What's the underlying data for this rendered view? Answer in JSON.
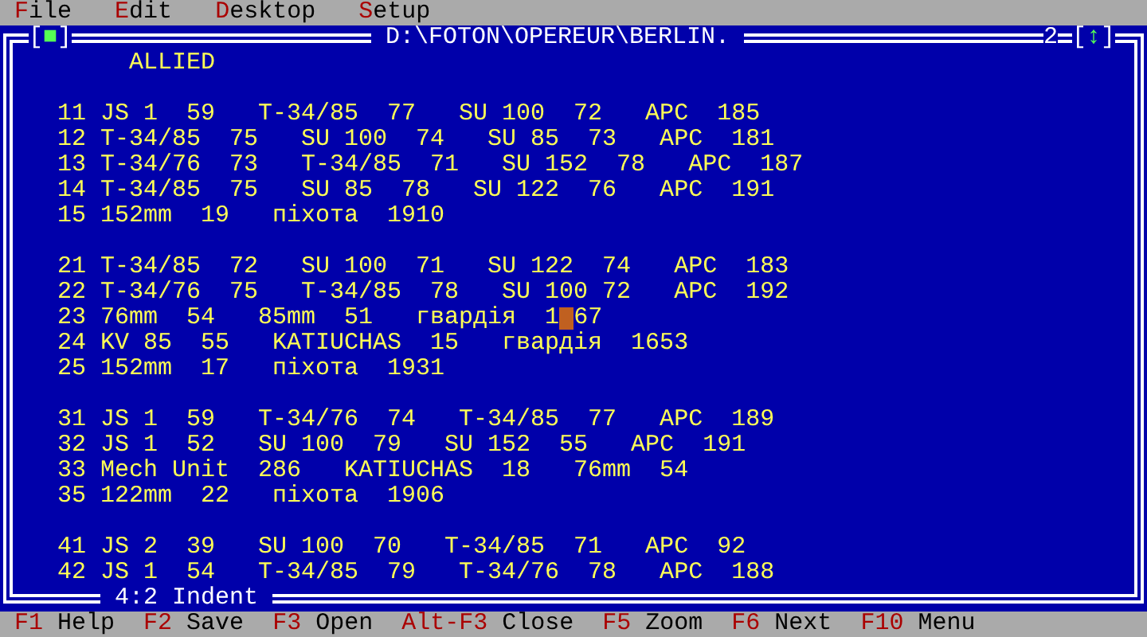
{
  "menu": [
    {
      "label": "File"
    },
    {
      "label": "Edit"
    },
    {
      "label": "Desktop"
    },
    {
      "label": "Setup"
    }
  ],
  "window": {
    "close_button": {
      "open": "[",
      "glyph": "■",
      "close": "]"
    },
    "title": "D:\\FOTON\\OPEREUR\\BERLIN.",
    "number": "2",
    "zoom_button": {
      "open": "[",
      "glyph": "↕",
      "close": "]"
    },
    "heading": "ALLIED",
    "blocks": [
      [
        {
          "text": "11 JS 1  59   T-34/85  77   SU 100  72   APC  185"
        },
        {
          "text": "12 T-34/85  75   SU 100  74   SU 85  73   APC  181"
        },
        {
          "text": "13 T-34/76  73   T-34/85  71   SU 152  78   APC  187"
        },
        {
          "text": "14 T-34/85  75   SU 85  78   SU 122  76   APC  191"
        },
        {
          "text": "15 152mm  19   піхота  1910"
        }
      ],
      [
        {
          "text": "21 T-34/85  72   SU 100  71   SU 122  74   APC  183"
        },
        {
          "text": "22 T-34/76  75   T-34/85  78   SU 100 72   APC  192"
        },
        {
          "text": "23 76mm  54   85mm  51   гвардія  1",
          "after_cursor": "67"
        },
        {
          "text": "24 KV 85  55   KATIUCHAS  15   гвардія  1653"
        },
        {
          "text": "25 152mm  17   піхота  1931"
        }
      ],
      [
        {
          "text": "31 JS 1  59   T-34/76  74   T-34/85  77   APC  189"
        },
        {
          "text": "32 JS 1  52   SU 100  79   SU 152  55   APC  191"
        },
        {
          "text": "33 Mech Unit  286   KATIUCHAS  18   76mm  54"
        },
        {
          "text": "35 122mm  22   піхота  1906"
        }
      ],
      [
        {
          "text": "41 JS 2  39   SU 100  70   T-34/85  71   APC  92"
        },
        {
          "text": "42 JS 1  54   T-34/85  79   T-34/76  78   APC  188"
        }
      ]
    ],
    "status": "4:2 Indent"
  },
  "function_keys": [
    {
      "key": "F1",
      "label": "Help"
    },
    {
      "key": "F2",
      "label": "Save"
    },
    {
      "key": "F3",
      "label": "Open"
    },
    {
      "key": "Alt-F3",
      "label": "Close"
    },
    {
      "key": "F5",
      "label": "Zoom"
    },
    {
      "key": "F6",
      "label": "Next"
    },
    {
      "key": "F10",
      "label": "Menu"
    }
  ]
}
